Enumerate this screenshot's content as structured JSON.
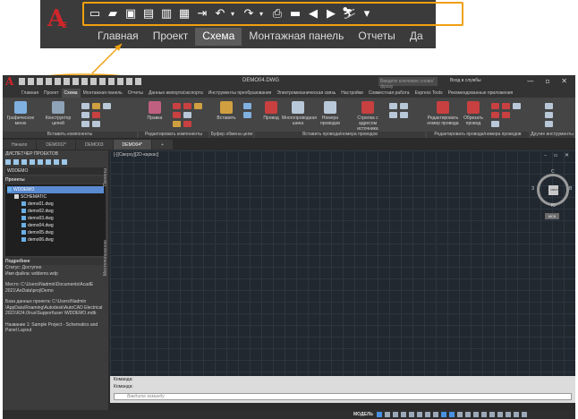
{
  "zoom": {
    "logo": "A",
    "logo_sub": "E",
    "qat_icons": [
      "new-icon",
      "open-icon",
      "save-as-icon",
      "save-icon",
      "saveall-icon",
      "publish-icon",
      "export-icon",
      "undo-icon",
      "redo-icon",
      "plot-icon",
      "folder-icon",
      "back-icon",
      "forward-icon",
      "workspace-icon",
      "dropdown-icon"
    ],
    "tabs": [
      "Главная",
      "Проект",
      "Схема",
      "Монтажная панель",
      "Отчеты",
      "Да"
    ],
    "active_tab": 2
  },
  "window": {
    "title": "DEMO04.DWG",
    "search_placeholder": "Введите ключевое слово/фразу",
    "login": "Вход в службы",
    "tabs": [
      "Главная",
      "Проект",
      "Схема",
      "Монтажная панель",
      "Отчеты",
      "Данные импорта/экспорта",
      "Инструменты преобразования",
      "Электромеханическая связь",
      "Настройки",
      "Совместная работа",
      "Express Tools",
      "Рекомендованные приложения"
    ],
    "active_tab": 2
  },
  "ribbon": {
    "groups": [
      {
        "label": "Вставить компоненты",
        "buttons": [
          "Графическое меню",
          "Конструктор цепей"
        ]
      },
      {
        "label": "Редактировать компоненты",
        "buttons": [
          "Правка"
        ]
      },
      {
        "label": "Буфер обмена цепи",
        "buttons": [
          "Вставить"
        ]
      },
      {
        "label": "Вставить провода/номера проводов",
        "buttons": [
          "Провод",
          "Многопроводная шина",
          "Номера проводов",
          "Стрелка с адресом источника"
        ]
      },
      {
        "label": "Редактировать провода/номера проводов",
        "buttons": [
          "Редактировать номер провода",
          "Обрезать провод"
        ]
      },
      {
        "label": "Другие инструменты",
        "buttons": []
      }
    ]
  },
  "doc_tabs": [
    "Начало",
    "DEMO02*",
    "DEMO03",
    "DEMO04*",
    "+"
  ],
  "doc_active": 3,
  "project_manager": {
    "header": "ДИСПЕТЧЕР ПРОЕКТОВ",
    "selected_project": "WDDEMO",
    "projects_label": "Проекты",
    "tree": [
      {
        "label": "WDDEMO",
        "level": 0,
        "type": "project"
      },
      {
        "label": "SCHEMATIC",
        "level": 1,
        "type": "folder"
      },
      {
        "label": "demo01.dwg",
        "level": 2,
        "type": "file"
      },
      {
        "label": "demo02.dwg",
        "level": 2,
        "type": "file"
      },
      {
        "label": "demo03.dwg",
        "level": 2,
        "type": "file"
      },
      {
        "label": "demo04.dwg",
        "level": 2,
        "type": "file"
      },
      {
        "label": "demo05.dwg",
        "level": 2,
        "type": "file"
      },
      {
        "label": "demo06.dwg",
        "level": 2,
        "type": "file"
      }
    ],
    "details_label": "Подробнее",
    "details": [
      "Статус: Доступно\nИмя файла: wddemo.wdp",
      "Место: C:\\Users\\Nadmin\\Documents\\AcadE 2021\\AeData\\proj\\Demo",
      "База данных проекта: C:\\Users\\Nadmin \\AppData\\Roaming\\Autodesk\\AutoCAD Electrical 2021\\R24.0\\rus\\Support\\user \\WDDEMO.mdb",
      "Название 1: Sample Project - Schematics and Panel Layout"
    ],
    "side_tabs": [
      "Проекты",
      "Местоположение"
    ]
  },
  "drawing": {
    "viewport_label": "[-][Сверху][2D-каркас]",
    "viewcube": {
      "n": "С",
      "s": "Ю",
      "w": "З",
      "e": "В",
      "face": "СВЕРХУ"
    },
    "ucs_label": "МСК"
  },
  "command": {
    "history": [
      "Команда:",
      "Команда:"
    ],
    "placeholder": "Введите команду"
  },
  "status": {
    "model": "МОДЕЛЬ"
  },
  "colors": {
    "accent_orange": "#f0a010",
    "brand_red": "#d0262b"
  }
}
